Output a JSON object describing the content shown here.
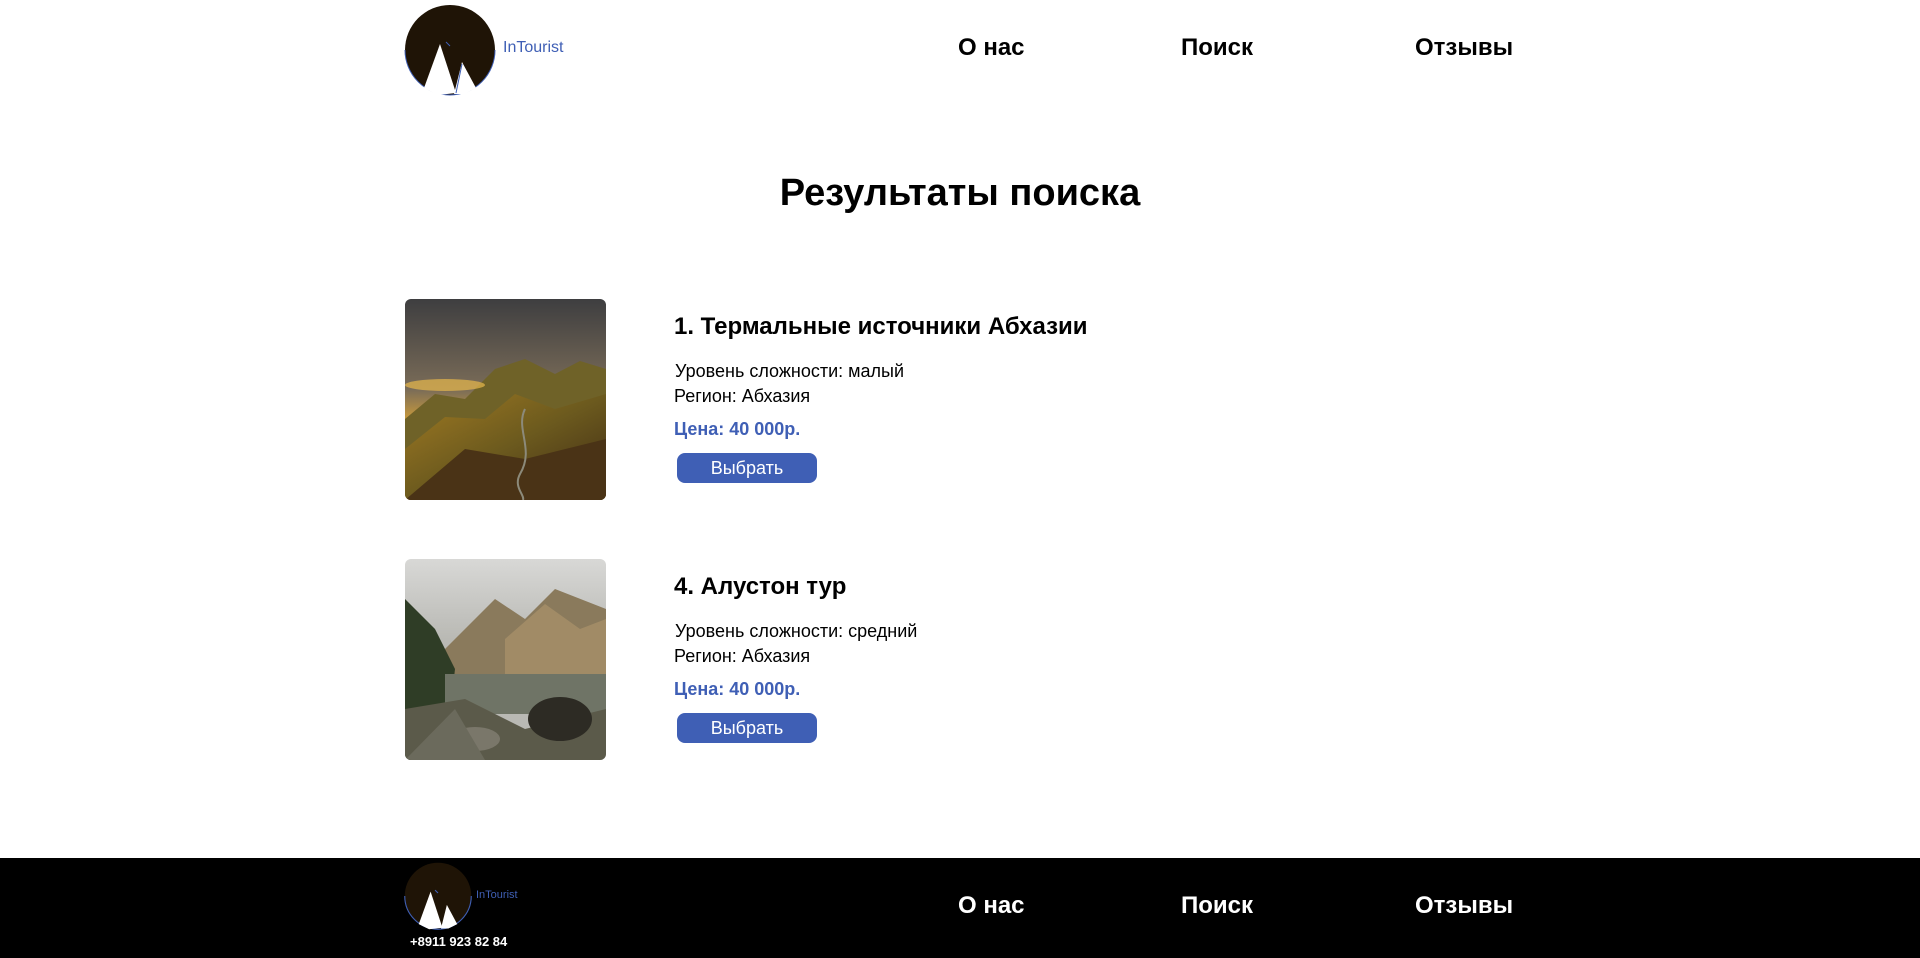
{
  "header": {
    "brand": "InTourist",
    "nav": {
      "about": "О нас",
      "search": "Поиск",
      "reviews": "Отзывы"
    }
  },
  "page_title": "Результаты поиска",
  "tours": [
    {
      "title": "1. Термальные источники Абхазии",
      "difficulty": "Уровень сложности: малый",
      "region": "Регион: Абхазия",
      "price": "Цена: 40 000р.",
      "button": "Выбрать",
      "photo_icon": "mountain-sunset-photo"
    },
    {
      "title": "4. Алустон тур",
      "difficulty": "Уровень сложности: средний",
      "region": "Регион: Абхазия",
      "price": "Цена: 40 000р.",
      "button": "Выбрать",
      "photo_icon": "mountain-lake-photo"
    }
  ],
  "footer": {
    "brand": "InTourist",
    "phone": "+8911 923 82 84",
    "nav": {
      "about": "О нас",
      "search": "Поиск",
      "reviews": "Отзывы"
    }
  },
  "colors": {
    "accent": "#3f5fb5",
    "logo_bg": "#1f1406",
    "footer_bg": "#000000"
  }
}
